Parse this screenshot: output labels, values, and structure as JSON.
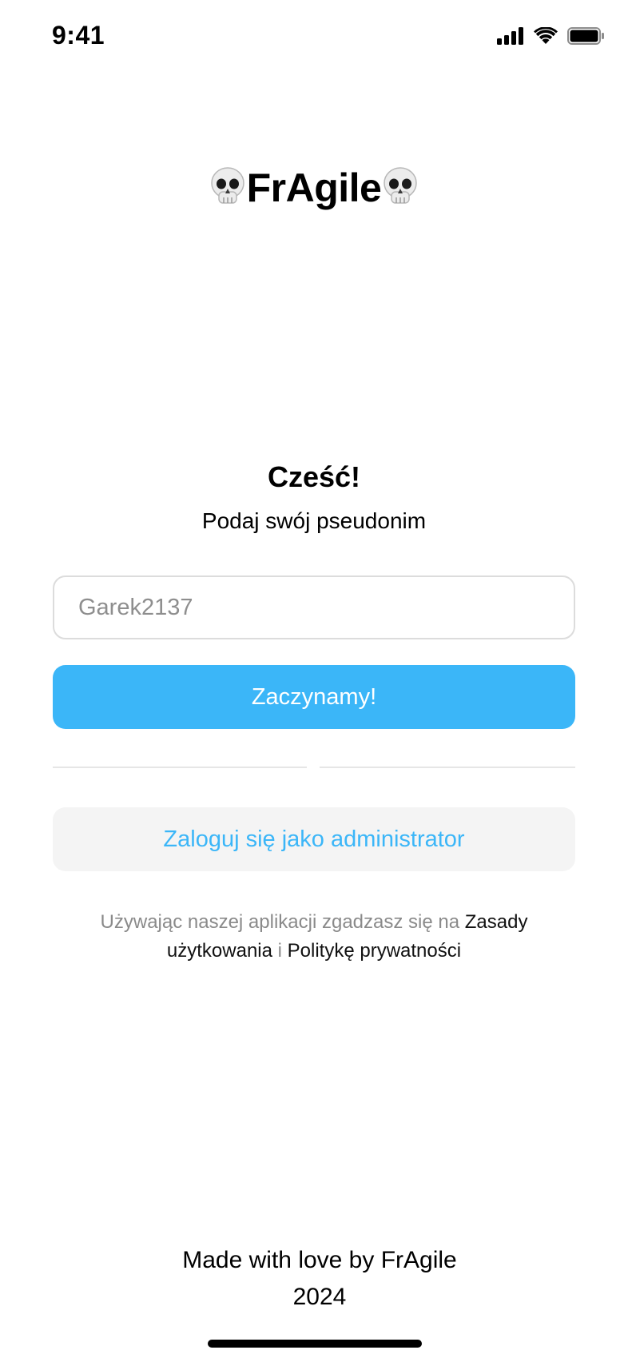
{
  "status_bar": {
    "time": "9:41",
    "icons": [
      "signal-icon",
      "wifi-icon",
      "battery-icon"
    ]
  },
  "header": {
    "app_name": "FrAgile",
    "logo_icon": "skull-icon"
  },
  "welcome": {
    "greeting": "Cześć!",
    "subtitle": "Podaj swój pseudonim"
  },
  "form": {
    "nickname_placeholder": "Garek2137",
    "nickname_value": "",
    "start_label": "Zaczynamy!",
    "admin_label": "Zaloguj się jako administrator"
  },
  "terms": {
    "prefix": "Używając naszej aplikacji zgadzasz się na ",
    "terms_link": "Zasady użytkowania",
    "joiner": " i ",
    "privacy_link": "Politykę prywatności"
  },
  "footer": {
    "line1": "Made with love by FrAgile",
    "line2": "2024"
  },
  "colors": {
    "accent": "#3bb6f8",
    "secondary_button_bg": "#f4f4f4",
    "input_border": "#dcdcdc",
    "muted_text": "#8a8a8a"
  }
}
